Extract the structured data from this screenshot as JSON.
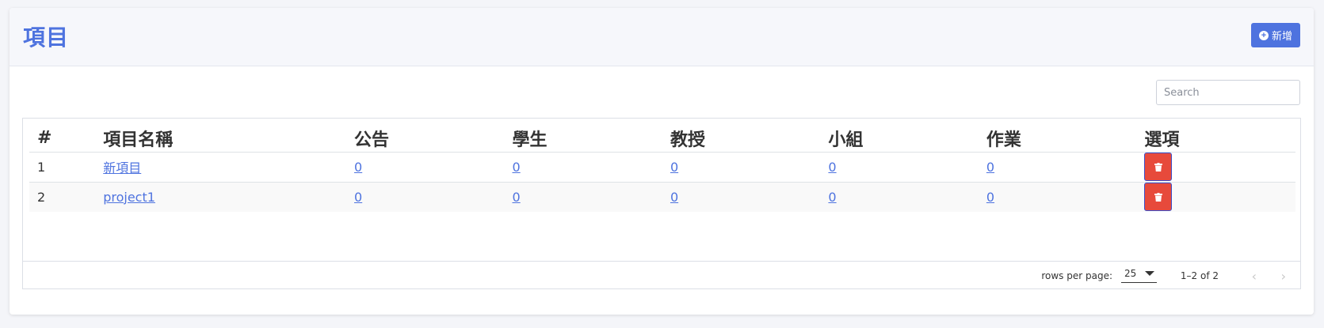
{
  "header": {
    "title": "項目",
    "add_label": "新增"
  },
  "search": {
    "placeholder": "Search"
  },
  "table": {
    "columns": [
      "#",
      "項目名稱",
      "公告",
      "學生",
      "教授",
      "小組",
      "作業",
      "選項"
    ],
    "rows": [
      {
        "index": "1",
        "name": "新項目",
        "announcements": "0",
        "students": "0",
        "professors": "0",
        "groups": "0",
        "assignments": "0"
      },
      {
        "index": "2",
        "name": "project1",
        "announcements": "0",
        "students": "0",
        "professors": "0",
        "groups": "0",
        "assignments": "0"
      }
    ]
  },
  "pagination": {
    "rows_per_page_label": "rows per page:",
    "rows_per_page_value": "25",
    "range_text": "1–2 of 2"
  },
  "colors": {
    "accent": "#4e73df",
    "danger": "#e74a3b"
  },
  "icons": {
    "add": "plus-circle-icon",
    "delete": "trash-icon",
    "prev": "chevron-left-icon",
    "next": "chevron-right-icon"
  }
}
